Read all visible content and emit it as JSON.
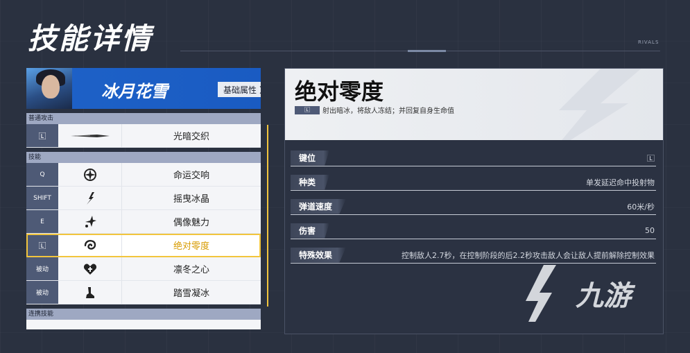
{
  "page": {
    "title": "技能详情",
    "brand": "RIVALS"
  },
  "hero": {
    "name": "冰月花雪",
    "attributes_button": "基础属性",
    "chevron": "〉"
  },
  "sections": [
    {
      "header": "普通攻击",
      "rows": [
        {
          "key": "🄻",
          "icon": "ice-blade-icon",
          "name": "光暗交织"
        }
      ]
    },
    {
      "header": "技能",
      "rows": [
        {
          "key": "Q",
          "icon": "star-sigil-icon",
          "name": "命运交响"
        },
        {
          "key": "SHIFT",
          "icon": "ice-crystal-icon",
          "name": "摇曳冰晶"
        },
        {
          "key": "E",
          "icon": "sparkle-icon",
          "name": "偶像魅力"
        },
        {
          "key": "🄻",
          "icon": "frost-swirl-icon",
          "name": "绝对零度",
          "selected": true
        },
        {
          "key": "被动",
          "icon": "heart-icon",
          "name": "凛冬之心"
        },
        {
          "key": "被动",
          "icon": "snow-step-icon",
          "name": "踏雪凝冰"
        }
      ]
    },
    {
      "header": "连携技能",
      "rows": []
    }
  ],
  "skill": {
    "title": "绝对零度",
    "key_chip": "🄻",
    "description": "射出暗冰，将敌人冻结；并回复自身生命值",
    "attributes": [
      {
        "label": "键位",
        "value": "🄻"
      },
      {
        "label": "种类",
        "value": "单发延迟命中投射物"
      },
      {
        "label": "弹道速度",
        "value": "60米/秒"
      },
      {
        "label": "伤害",
        "value": "50"
      },
      {
        "label": "特殊效果",
        "value": "控制敌人2.7秒，在控制阶段的后2.2秒攻击敌人会让敌人提前解除控制效果"
      }
    ]
  },
  "watermark": {
    "text": "九游"
  },
  "colors": {
    "accent": "#f2c53d",
    "hero_bg": "#1e62c8",
    "key_bg": "#4e5a76",
    "page_bg": "#2a3140"
  }
}
